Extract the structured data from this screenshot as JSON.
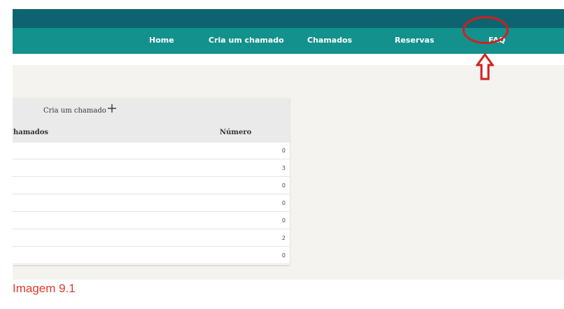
{
  "nav": {
    "items": [
      {
        "label": "Home"
      },
      {
        "label": "Cria um chamado"
      },
      {
        "label": "Chamados"
      },
      {
        "label": "Reservas"
      },
      {
        "label": "FAQ"
      }
    ]
  },
  "panel": {
    "create_label": "Cria um chamado",
    "create_icon": "plus-icon",
    "columns": {
      "chamados": "Chamados",
      "numero": "Número"
    },
    "rows": [
      {
        "value": "0"
      },
      {
        "value": "3"
      },
      {
        "value": "0"
      },
      {
        "value": "0"
      },
      {
        "value": "0"
      },
      {
        "value": "2"
      },
      {
        "value": "0"
      }
    ]
  },
  "annotation": {
    "highlight": "FAQ",
    "color": "#d61d1d",
    "arrow_icon": "up-arrow-icon"
  },
  "caption": "Imagem 9.1",
  "colors": {
    "topbar": "#0d6470",
    "navbar": "#13918d",
    "background": "#f4f3ef"
  }
}
